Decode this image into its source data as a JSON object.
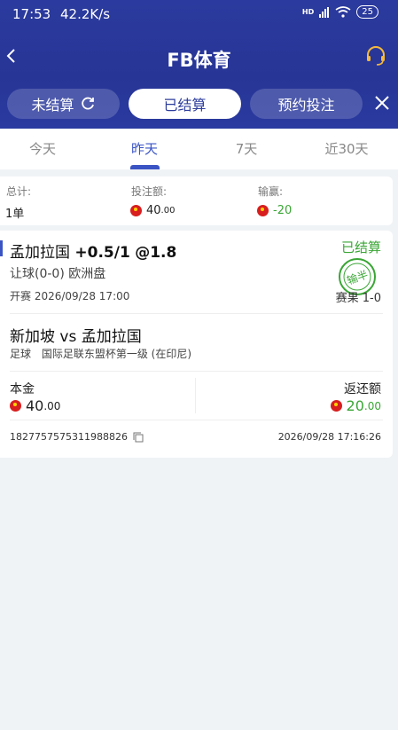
{
  "status_bar": {
    "time": "17:53",
    "speed": "42.2K/s",
    "signal": "HD",
    "battery": "25"
  },
  "header": {
    "title": "FB体育"
  },
  "tabs": [
    {
      "label": "未结算"
    },
    {
      "label": "已结算"
    },
    {
      "label": "预约投注"
    }
  ],
  "date_tabs": [
    {
      "label": "今天"
    },
    {
      "label": "昨天"
    },
    {
      "label": "7天"
    },
    {
      "label": "近30天"
    }
  ],
  "summary": {
    "total_label": "总计:",
    "total_value": "1单",
    "bet_label": "投注额:",
    "bet_value_main": "40",
    "bet_value_decimal": ".00",
    "winloss_label": "输赢:",
    "winloss_value": "-20"
  },
  "bet": {
    "team": "孟加拉国",
    "handicap": "+0.5/1",
    "odds": "@1.8",
    "status": "已结算",
    "stamp_text": "输半",
    "market": "让球(0-0) 欧洲盘",
    "kickoff": "开赛 2026/09/28 17:00",
    "score": "赛果 1-0",
    "teams": "新加坡 vs 孟加拉国",
    "sport": "足球",
    "league": "国际足联东盟杯第一级 (在印尼)",
    "principal_label": "本金",
    "principal_main": "40",
    "principal_decimal": ".00",
    "return_label": "返还额",
    "return_main": "20",
    "return_decimal": ".00",
    "order_id": "1827757575311988826",
    "timestamp": "2026/09/28 17:16:26"
  },
  "colors": {
    "header": "#2b3a9e",
    "accent": "#3b54c4",
    "win": "#3aa635",
    "coin": "#d81e1e"
  }
}
